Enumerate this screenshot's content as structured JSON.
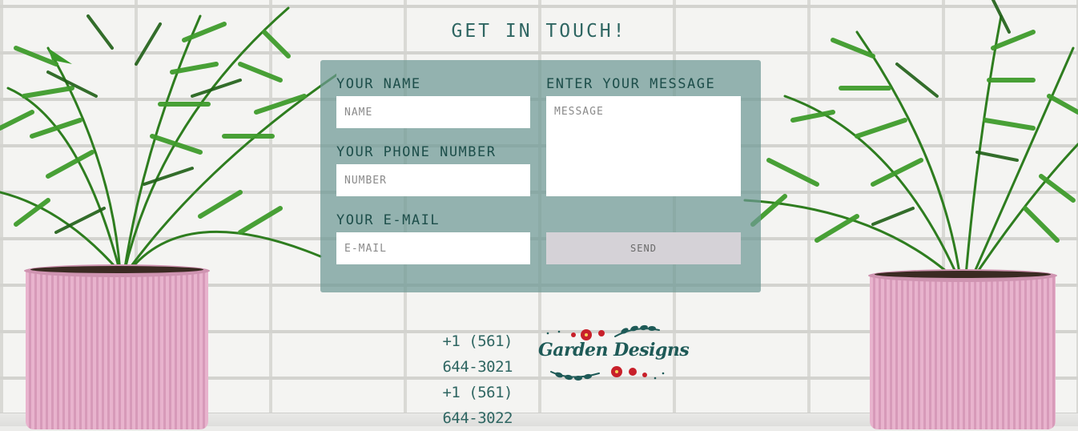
{
  "header": {
    "title": "GET IN TOUCH!"
  },
  "form": {
    "name_label": "YOUR NAME",
    "name_placeholder": "NAME",
    "phone_label": "YOUR PHONE NUMBER",
    "phone_placeholder": "NUMBER",
    "email_label": "YOUR E-MAIL",
    "email_placeholder": "E-MAIL",
    "message_label": "ENTER YOUR MESSAGE",
    "message_placeholder": "MESSAGE",
    "send_label": "SEND"
  },
  "contact": {
    "phones": [
      "+1 (561) 644-3021",
      "+1 (561) 644-3022"
    ]
  },
  "logo": {
    "text": "Garden Designs"
  },
  "colors": {
    "accent": "#2f6662",
    "panel": "#6d9894",
    "pot": "#e8b3cd",
    "foliage": "#2e7d1f",
    "logo_flower": "#c8202a"
  }
}
